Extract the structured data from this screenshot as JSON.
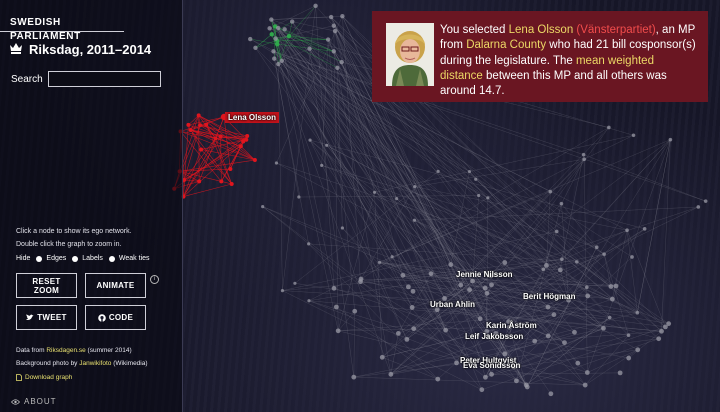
{
  "sidebar": {
    "tag": "SWEDISH PARLIAMENT",
    "title": "Riksdag, 2011–2014",
    "search_label": "Search",
    "search_value": "",
    "help_1": "Click a node to show its ego network.",
    "help_2": "Double click the graph to zoom in.",
    "hide_label": "Hide",
    "hide_options": [
      "Edges",
      "Labels",
      "Weak ties"
    ],
    "buttons": {
      "reset_zoom": "RESET ZOOM",
      "animate": "ANIMATE",
      "tweet": "TWEET",
      "code": "CODE"
    },
    "credits": {
      "data_prefix": "Data from ",
      "data_link": "Riksdagen.se",
      "data_suffix": " (summer 2014)",
      "photo_prefix": "Background photo by ",
      "photo_link": "Janwikifoto",
      "photo_suffix": " (Wikimedia)",
      "download": "Download graph"
    },
    "about": "ABOUT"
  },
  "info": {
    "t1": "You selected ",
    "name": "Lena Olsson",
    "party": " (Vänsterpartiet)",
    "t2": ", an MP from ",
    "county": "Dalarna County",
    "t3": " who had 21 bill cosponsor(s) during the legislature. The ",
    "metric": "mean weighted distance",
    "t4": " between this MP and all others was around 14.7."
  },
  "graph": {
    "colors": {
      "selected": "#e0151e",
      "green": "#2fa84b",
      "node": "#9a9aa6",
      "edge": "#8a8a96"
    },
    "labels": [
      "Lena Olsson",
      "Jennie Nilsson",
      "Berit Högman",
      "Urban Ahlin",
      "Karin Åström",
      "Leif Jakobsson",
      "Peter Hultqvist",
      "Eva Sonidsson"
    ]
  }
}
